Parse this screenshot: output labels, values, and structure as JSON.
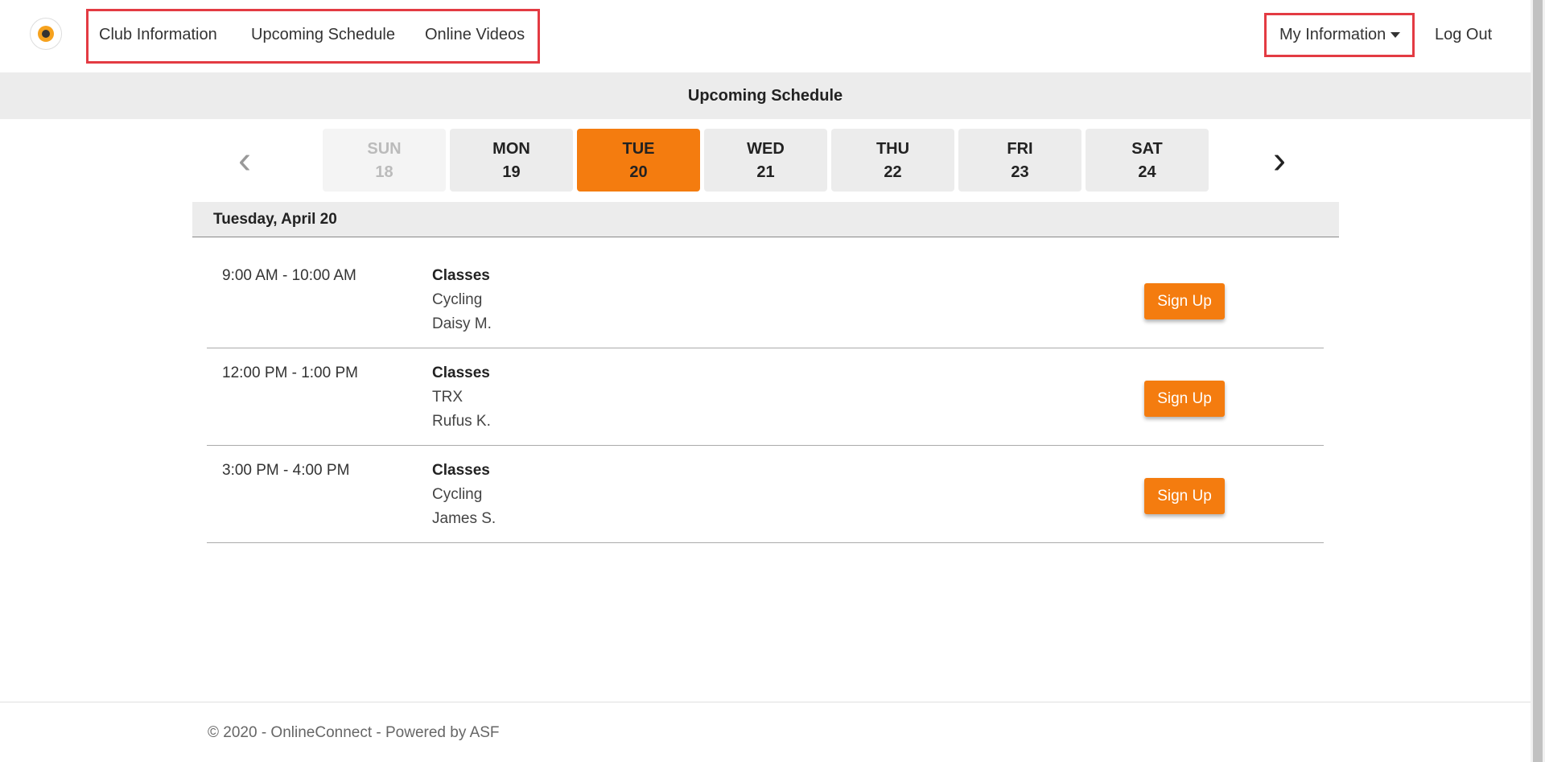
{
  "nav": {
    "links": [
      "Club Information",
      "Upcoming Schedule",
      "Online Videos"
    ],
    "my_information": "My Information",
    "log_out": "Log Out"
  },
  "subheader": {
    "title": "Upcoming Schedule"
  },
  "week": {
    "prev_icon": "chevron-left-icon",
    "next_icon": "chevron-right-icon",
    "days": [
      {
        "name": "SUN",
        "num": "18",
        "state": "past"
      },
      {
        "name": "MON",
        "num": "19",
        "state": "normal"
      },
      {
        "name": "TUE",
        "num": "20",
        "state": "active"
      },
      {
        "name": "WED",
        "num": "21",
        "state": "normal"
      },
      {
        "name": "THU",
        "num": "22",
        "state": "normal"
      },
      {
        "name": "FRI",
        "num": "23",
        "state": "normal"
      },
      {
        "name": "SAT",
        "num": "24",
        "state": "normal"
      }
    ]
  },
  "schedule": {
    "date_label": "Tuesday, April 20",
    "sessions": [
      {
        "time": "9:00 AM - 10:00 AM",
        "category": "Classes",
        "name": "Cycling",
        "instructor": "Daisy M.",
        "button": "Sign Up"
      },
      {
        "time": "12:00 PM - 1:00 PM",
        "category": "Classes",
        "name": "TRX",
        "instructor": "Rufus K.",
        "button": "Sign Up"
      },
      {
        "time": "3:00 PM - 4:00 PM",
        "category": "Classes",
        "name": "Cycling",
        "instructor": "James S.",
        "button": "Sign Up"
      }
    ]
  },
  "footer": {
    "text": "© 2020 - OnlineConnect - Powered by ASF"
  },
  "colors": {
    "accent": "#f47c0f",
    "highlight_box": "#e33b43"
  }
}
